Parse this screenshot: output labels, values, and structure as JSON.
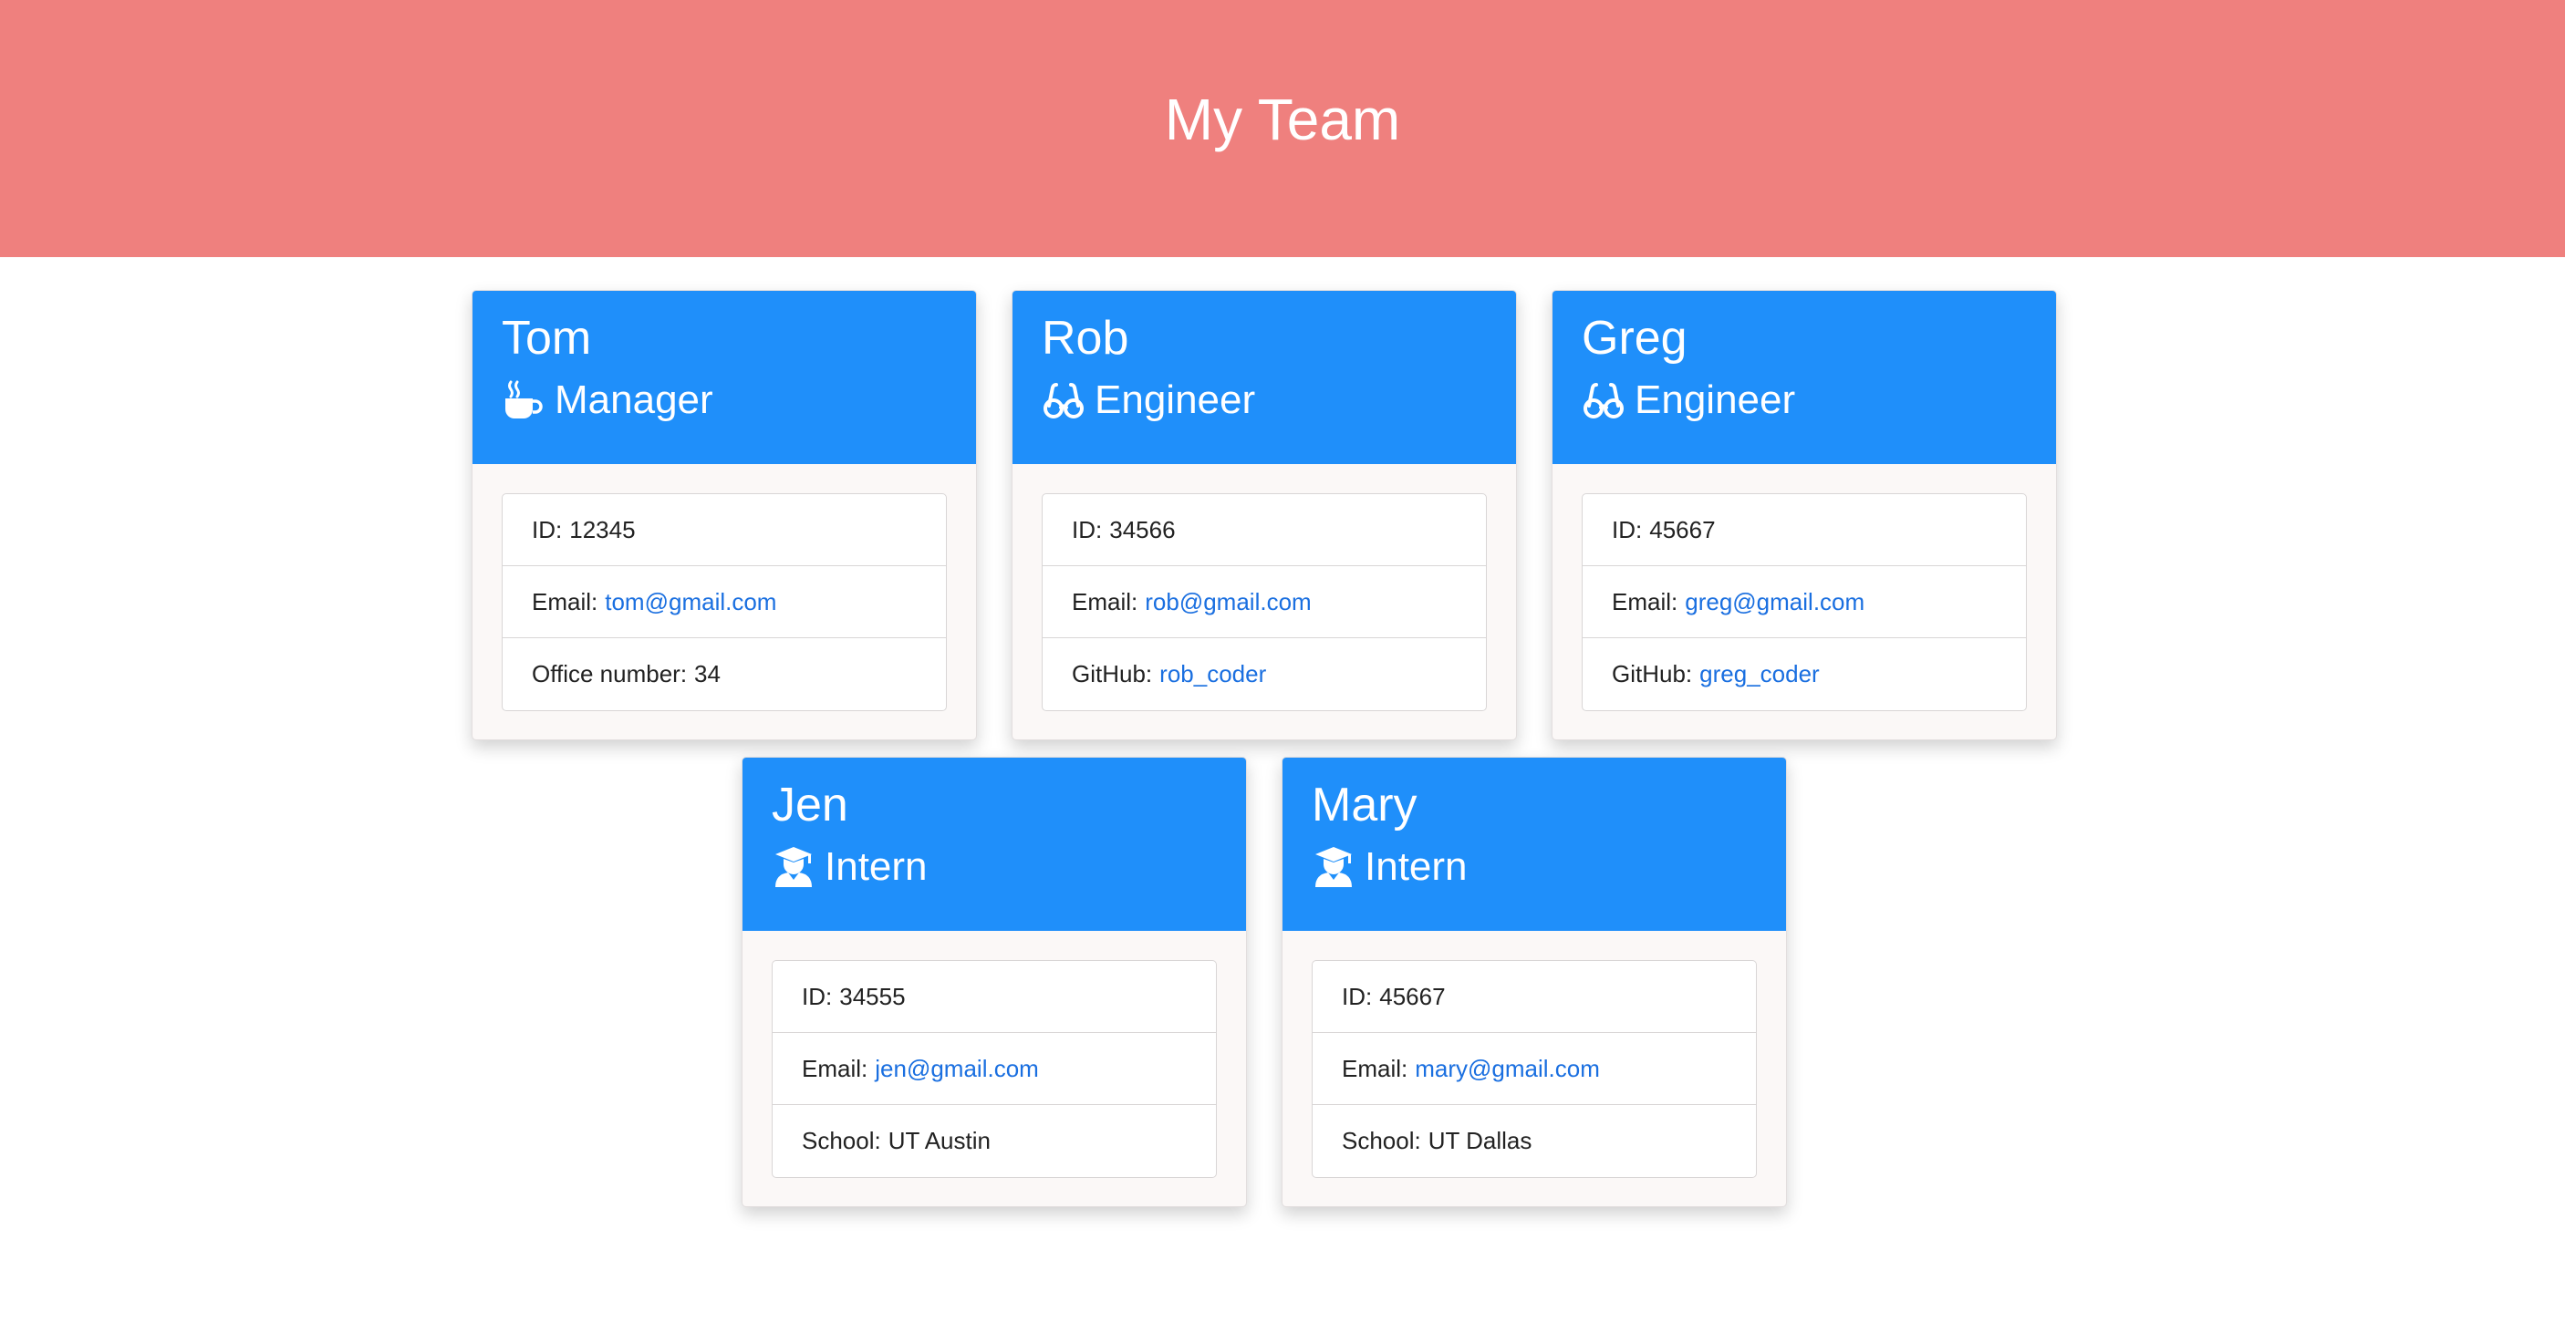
{
  "header": {
    "title": "My Team"
  },
  "employees": [
    {
      "name": "Tom",
      "role": "Manager",
      "icon": "coffee-icon",
      "id_label": "ID:",
      "id": "12345",
      "email_label": "Email:",
      "email": "tom@gmail.com",
      "extra_label": "Office number:",
      "extra": "34"
    },
    {
      "name": "Rob",
      "role": "Engineer",
      "icon": "glasses-icon",
      "id_label": "ID:",
      "id": "34566",
      "email_label": "Email:",
      "email": "rob@gmail.com",
      "extra_label": "GitHub:",
      "extra": "rob_coder"
    },
    {
      "name": "Greg",
      "role": "Engineer",
      "icon": "glasses-icon",
      "id_label": "ID:",
      "id": "45667",
      "email_label": "Email:",
      "email": "greg@gmail.com",
      "extra_label": "GitHub:",
      "extra": "greg_coder"
    },
    {
      "name": "Jen",
      "role": "Intern",
      "icon": "graduate-icon",
      "id_label": "ID:",
      "id": "34555",
      "email_label": "Email:",
      "email": "jen@gmail.com",
      "extra_label": "School:",
      "extra": "UT Austin"
    },
    {
      "name": "Mary",
      "role": "Intern",
      "icon": "graduate-icon",
      "id_label": "ID:",
      "id": "45667",
      "email_label": "Email:",
      "email": "mary@gmail.com",
      "extra_label": "School:",
      "extra": "UT Dallas"
    }
  ],
  "colors": {
    "header_bg": "#ef807e",
    "card_header_bg": "#1f8ffa",
    "link": "#1a6fe0"
  }
}
